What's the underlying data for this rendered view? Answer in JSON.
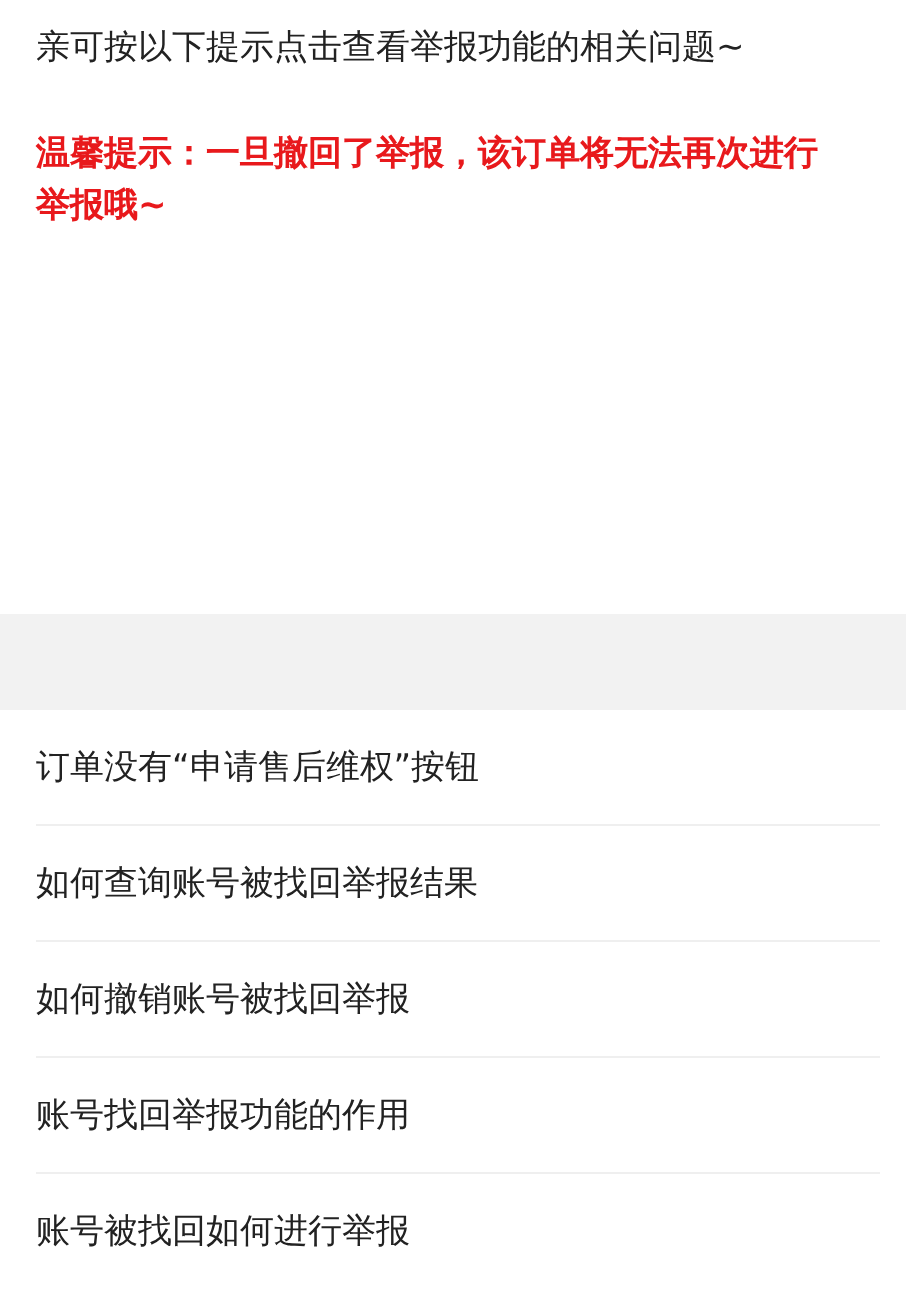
{
  "intro": "亲可按以下提示点击查看举报功能的相关问题~",
  "warning": "温馨提示：一旦撤回了举报，该订单将无法再次进行举报哦~",
  "questions": [
    "订单没有“申请售后维权”按钮",
    "如何查询账号被找回举报结果",
    "如何撤销账号被找回举报",
    "账号找回举报功能的作用",
    "账号被找回如何进行举报"
  ]
}
